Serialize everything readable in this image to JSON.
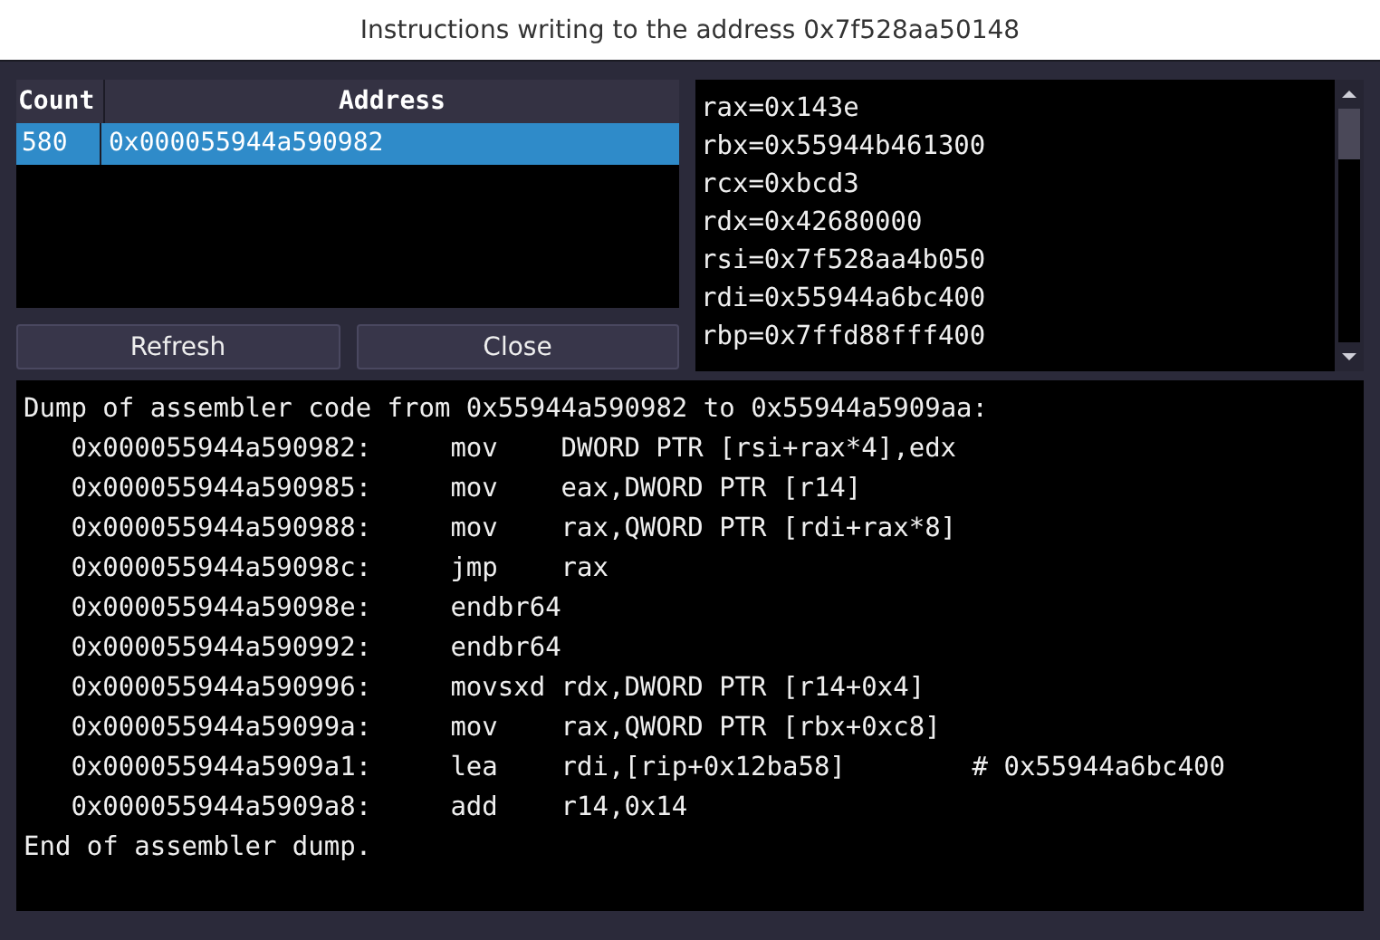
{
  "window": {
    "title": "Instructions writing to the address 0x7f528aa50148"
  },
  "table": {
    "columns": [
      "Count",
      "Address"
    ],
    "rows": [
      {
        "count": "580",
        "address": "0x000055944a590982",
        "selected": true
      }
    ]
  },
  "buttons": [
    "Refresh",
    "Close"
  ],
  "registers": [
    "rax=0x143e",
    "rbx=0x55944b461300",
    "rcx=0xbcd3",
    "rdx=0x42680000",
    "rsi=0x7f528aa4b050",
    "rdi=0x55944a6bc400",
    "rbp=0x7ffd88fff400"
  ],
  "disassembly": {
    "header": "Dump of assembler code from 0x55944a590982 to 0x55944a5909aa:",
    "instructions": [
      {
        "address": "0x000055944a590982:",
        "mnemonic": "mov",
        "operands": "DWORD PTR [rsi+rax*4],edx"
      },
      {
        "address": "0x000055944a590985:",
        "mnemonic": "mov",
        "operands": "eax,DWORD PTR [r14]"
      },
      {
        "address": "0x000055944a590988:",
        "mnemonic": "mov",
        "operands": "rax,QWORD PTR [rdi+rax*8]"
      },
      {
        "address": "0x000055944a59098c:",
        "mnemonic": "jmp",
        "operands": "rax"
      },
      {
        "address": "0x000055944a59098e:",
        "mnemonic": "endbr64"
      },
      {
        "address": "0x000055944a590992:",
        "mnemonic": "endbr64"
      },
      {
        "address": "0x000055944a590996:",
        "mnemonic": "movsxd",
        "operands": "rdx,DWORD PTR [r14+0x4]"
      },
      {
        "address": "0x000055944a59099a:",
        "mnemonic": "mov",
        "operands": "rax,QWORD PTR [rbx+0xc8]"
      },
      {
        "address": "0x000055944a5909a1:",
        "mnemonic": "lea",
        "operands": "rdi,[rip+0x12ba58]",
        "comment": "# 0x55944a6bc400"
      },
      {
        "address": "0x000055944a5909a8:",
        "mnemonic": "add",
        "operands": "r14,0x14"
      }
    ],
    "footer": "End of assembler dump."
  }
}
